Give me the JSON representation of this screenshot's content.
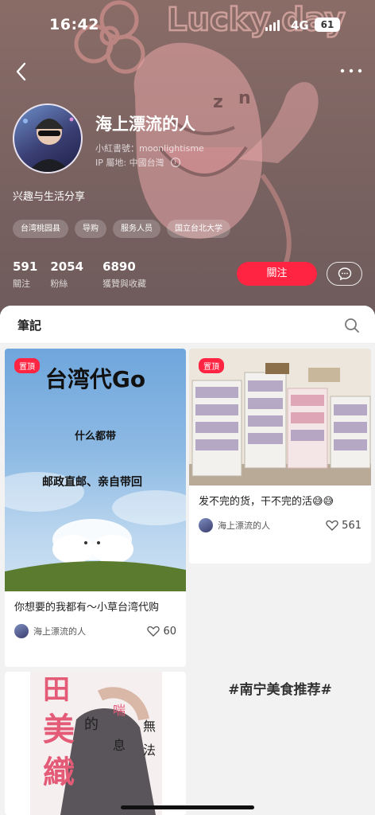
{
  "status_bar": {
    "time": "16:42",
    "network": "4G",
    "battery": "61"
  },
  "profile": {
    "nickname": "海上漂流的人",
    "red_id": "小紅書號：moonlightisme",
    "ip_location": "IP 屬地: 中國台灣",
    "bio": "兴趣与生活分享",
    "background_text": "Lucky day",
    "tags": [
      "台湾桃园县",
      "导购",
      "服务人员",
      "国立台北大学"
    ],
    "stats": [
      {
        "value": "591",
        "label": "關注"
      },
      {
        "value": "2054",
        "label": "粉絲"
      },
      {
        "value": "6890",
        "label": "獲贊與收藏"
      }
    ],
    "follow_label": "關注"
  },
  "notes": {
    "section_label": "筆記",
    "pin_label": "置頂",
    "cards": [
      {
        "title": "你想要的我都有～小草台湾代购",
        "author": "海上漂流的人",
        "likes": "60",
        "image_text": {
          "headline": "台湾代Go",
          "line1": "什么都带",
          "line2": "邮政直邮、亲自带回"
        }
      },
      {
        "title": "发不完的货，干不完的活😅😅",
        "author": "海上漂流的人",
        "likes": "561"
      },
      {
        "plain_text": "#南宁美食推荐#"
      },
      {
        "image_text": {
          "big1": "田",
          "big2": "美",
          "big3": "織",
          "vertical1": "的",
          "vertical2": "喘",
          "vertical3": "息",
          "vertical4": "無",
          "vertical5": "法"
        }
      }
    ]
  },
  "colors": {
    "accent": "#ff2442",
    "header_bg": "#7c6462"
  }
}
